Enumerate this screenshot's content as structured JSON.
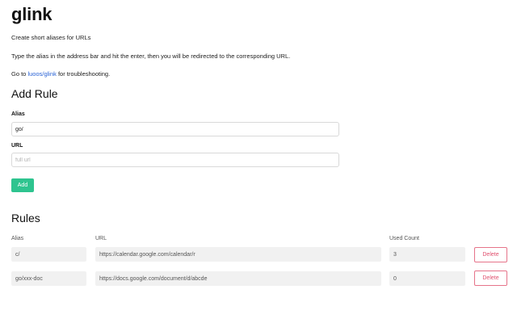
{
  "header": {
    "title": "glink",
    "description": "Create short aliases for URLs",
    "instructions": "Type the alias in the address bar and hit the enter, then you will be redirected to the corresponding URL.",
    "help_prefix": "Go to ",
    "help_link": "luoos/glink",
    "help_suffix": " for troubleshooting."
  },
  "add_rule": {
    "heading": "Add Rule",
    "alias_label": "Alias",
    "alias_value": "go/",
    "url_label": "URL",
    "url_placeholder": "full url",
    "add_button": "Add"
  },
  "rules": {
    "heading": "Rules",
    "columns": {
      "alias": "Alias",
      "url": "URL",
      "used_count": "Used Count"
    },
    "rows": [
      {
        "alias": "c/",
        "url": "https://calendar.google.com/calendar/r",
        "used_count": "3",
        "delete_label": "Delete"
      },
      {
        "alias": "go/xxx-doc",
        "url": "https://docs.google.com/document/d/abcde",
        "used_count": "0",
        "delete_label": "Delete"
      }
    ]
  },
  "colors": {
    "add_button": "#2ec48f",
    "link": "#2a63d6",
    "delete": "#e0506e"
  }
}
